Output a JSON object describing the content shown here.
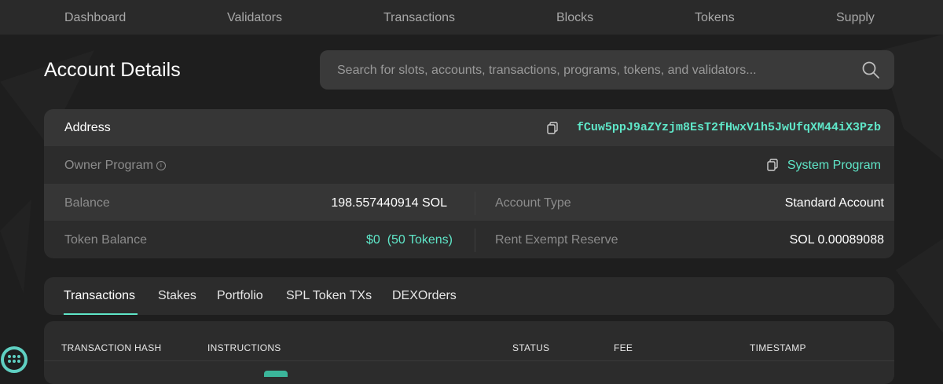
{
  "nav": {
    "items": [
      {
        "label": "Dashboard"
      },
      {
        "label": "Validators"
      },
      {
        "label": "Transactions"
      },
      {
        "label": "Blocks"
      },
      {
        "label": "Tokens"
      },
      {
        "label": "Supply"
      }
    ]
  },
  "page": {
    "title": "Account Details"
  },
  "search": {
    "placeholder": "Search for slots, accounts, transactions, programs, tokens, and validators...",
    "icon": "search-icon"
  },
  "account": {
    "address_label": "Address",
    "address_value": "fCuw5ppJ9aZYzjm8EsT2fHwxV1h5JwUfqXM44iX3Pzb",
    "owner_label": "Owner Program",
    "owner_value": "System Program",
    "balance_label": "Balance",
    "balance_value": "198.557440914 SOL",
    "account_type_label": "Account Type",
    "account_type_value": "Standard Account",
    "token_balance_label": "Token Balance",
    "token_balance_value": "$0  (50 Tokens)",
    "rent_label": "Rent Exempt Reserve",
    "rent_value": "SOL 0.00089088"
  },
  "tabs": [
    {
      "label": "Transactions",
      "active": true
    },
    {
      "label": "Stakes"
    },
    {
      "label": "Portfolio"
    },
    {
      "label": "SPL Token TXs"
    },
    {
      "label": "DEXOrders"
    }
  ],
  "table": {
    "columns": [
      "TRANSACTION HASH",
      "INSTRUCTIONS",
      "STATUS",
      "FEE",
      "TIMESTAMP"
    ]
  },
  "colors": {
    "accent": "#5fe6c8",
    "background": "#1e1e1e",
    "card": "#2c2c2c"
  }
}
